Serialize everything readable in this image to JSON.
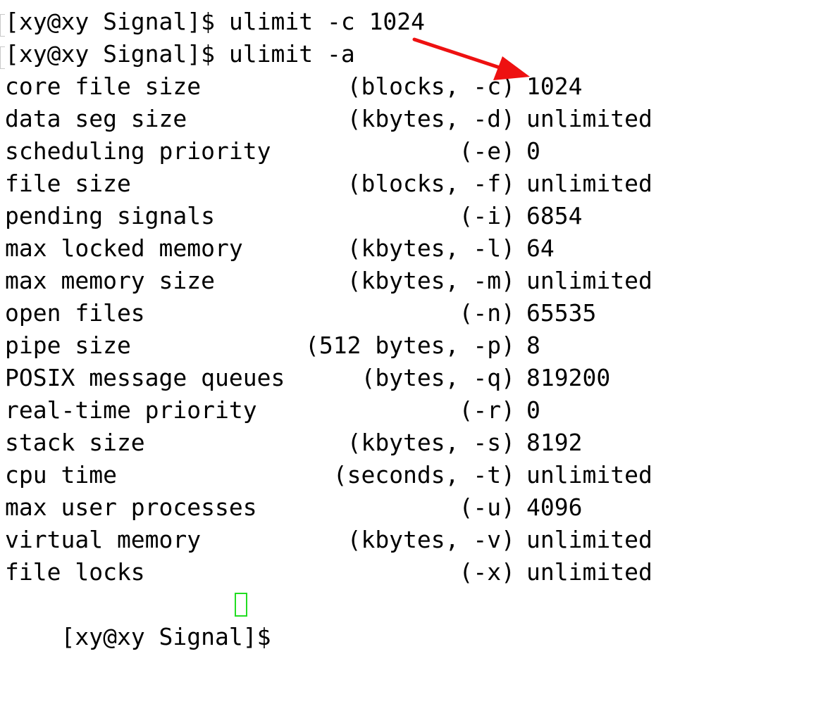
{
  "terminal": {
    "prompt_lines": [
      {
        "prompt": "[xy@xy Signal]$",
        "command": "ulimit -c 1024"
      },
      {
        "prompt": "[xy@xy Signal]$",
        "command": "ulimit -a"
      }
    ],
    "rows": [
      {
        "label": "core file size",
        "unit": "(blocks, -c)",
        "value": "1024"
      },
      {
        "label": "data seg size",
        "unit": "(kbytes, -d)",
        "value": "unlimited"
      },
      {
        "label": "scheduling priority",
        "unit": "(-e)",
        "value": "0"
      },
      {
        "label": "file size",
        "unit": "(blocks, -f)",
        "value": "unlimited"
      },
      {
        "label": "pending signals",
        "unit": "(-i)",
        "value": "6854"
      },
      {
        "label": "max locked memory",
        "unit": "(kbytes, -l)",
        "value": "64"
      },
      {
        "label": "max memory size",
        "unit": "(kbytes, -m)",
        "value": "unlimited"
      },
      {
        "label": "open files",
        "unit": "(-n)",
        "value": "65535"
      },
      {
        "label": "pipe size",
        "unit": "(512 bytes, -p)",
        "value": "8"
      },
      {
        "label": "POSIX message queues",
        "unit": "(bytes, -q)",
        "value": "819200"
      },
      {
        "label": "real-time priority",
        "unit": "(-r)",
        "value": "0"
      },
      {
        "label": "stack size",
        "unit": "(kbytes, -s)",
        "value": "8192"
      },
      {
        "label": "cpu time",
        "unit": "(seconds, -t)",
        "value": "unlimited"
      },
      {
        "label": "max user processes",
        "unit": "(-u)",
        "value": "4096"
      },
      {
        "label": "virtual memory",
        "unit": "(kbytes, -v)",
        "value": "unlimited"
      },
      {
        "label": "file locks",
        "unit": "(-x)",
        "value": "unlimited"
      }
    ],
    "final_prompt": "[xy@xy Signal]$"
  },
  "colors": {
    "background": "#ffffff",
    "text": "#000000",
    "annotation_arrow": "#ee1111",
    "cursor": "#22dd22"
  },
  "icons": {
    "annotation": "red-arrow-icon",
    "cursor": "block-cursor-icon"
  }
}
